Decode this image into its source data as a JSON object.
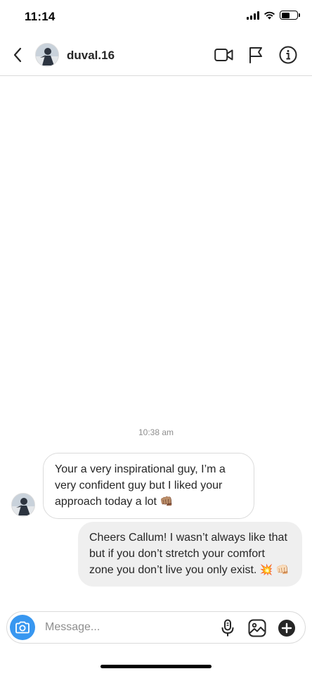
{
  "status_bar": {
    "time": "11:14"
  },
  "header": {
    "username": "duval.16"
  },
  "conversation": {
    "timestamp": "10:38 am",
    "messages": [
      {
        "direction": "received",
        "text": "Your a very inspirational guy, I’m a very confident guy but I liked your approach today a lot",
        "emoji": "👊🏽"
      },
      {
        "direction": "sent",
        "text": "Cheers Callum! I wasn’t always like that but if you don’t stretch your comfort zone you don’t live you only exist.",
        "emoji": "💥 👊🏻"
      }
    ]
  },
  "composer": {
    "placeholder": "Message..."
  },
  "colors": {
    "accent": "#3897f0",
    "sent_bubble": "#efefef",
    "border": "#dbdbdb",
    "muted_text": "#8e8e8e"
  },
  "icons": [
    "back-chevron-icon",
    "video-call-icon",
    "flag-icon",
    "info-icon",
    "camera-icon",
    "microphone-icon",
    "gallery-icon",
    "plus-circle-icon"
  ]
}
